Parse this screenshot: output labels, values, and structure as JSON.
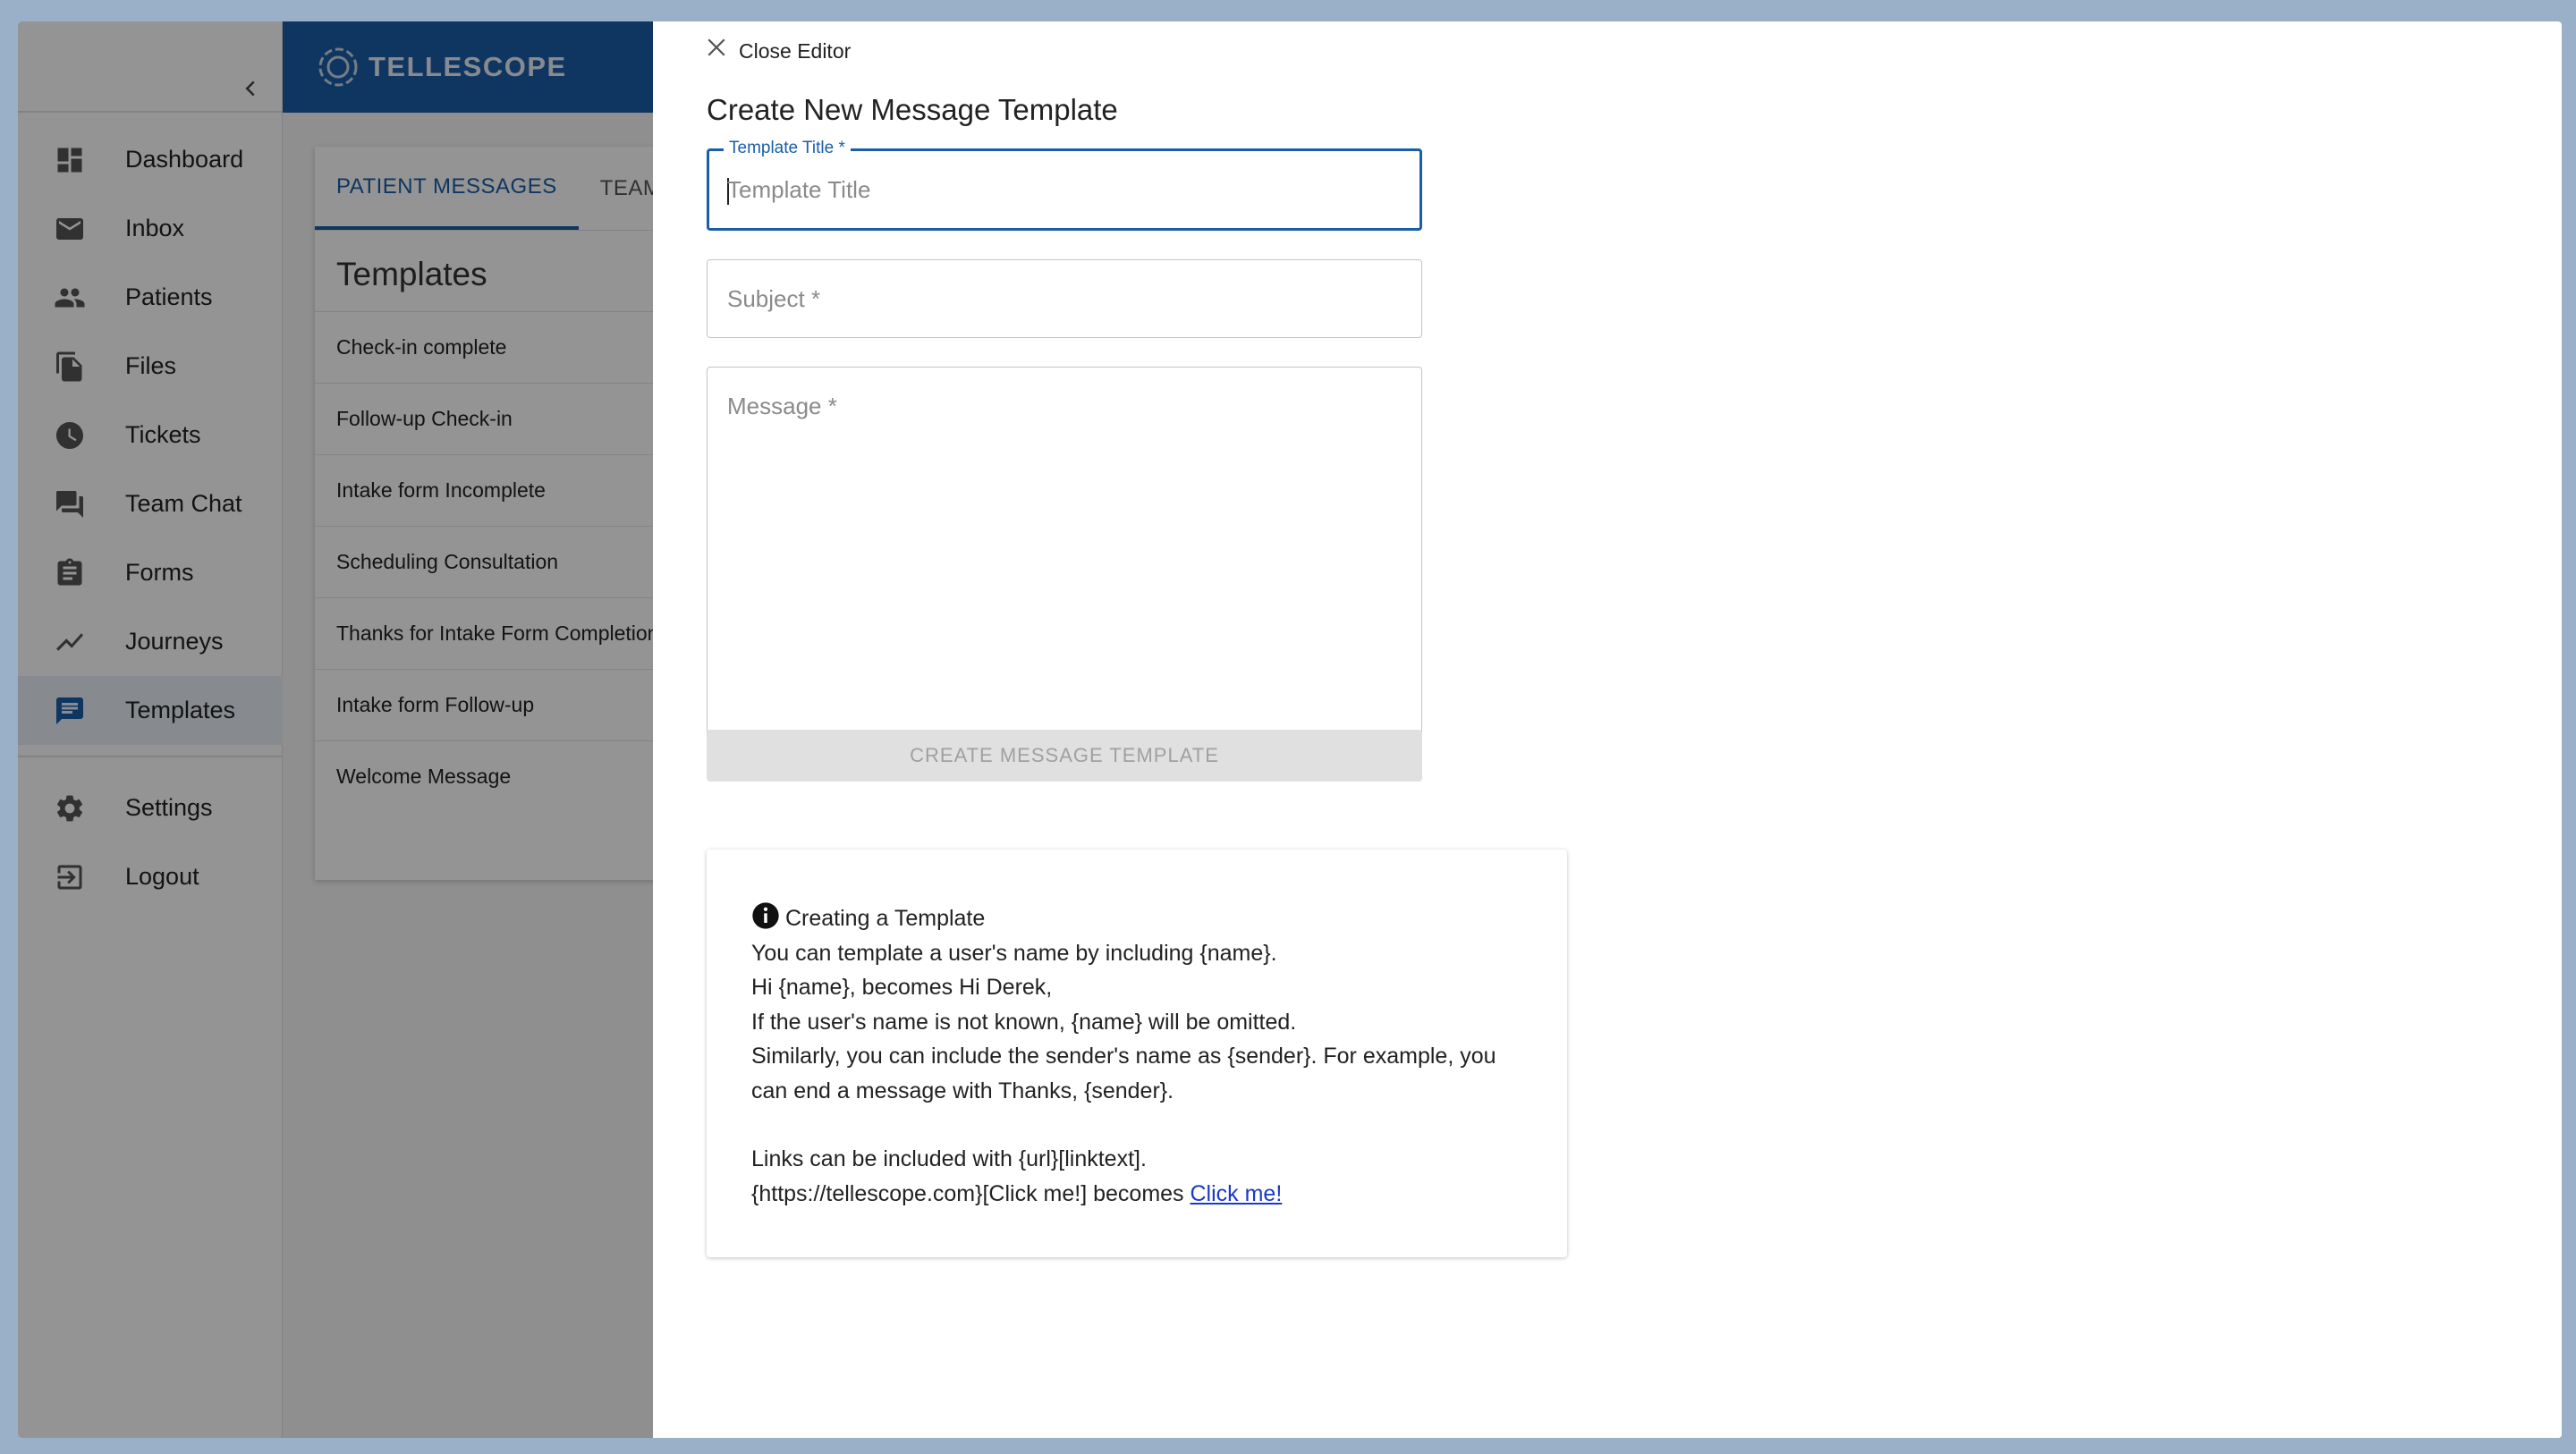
{
  "sidebar": {
    "items": [
      {
        "label": "Dashboard",
        "icon": "dashboard-icon"
      },
      {
        "label": "Inbox",
        "icon": "mail-icon"
      },
      {
        "label": "Patients",
        "icon": "people-icon"
      },
      {
        "label": "Files",
        "icon": "files-icon"
      },
      {
        "label": "Tickets",
        "icon": "clock-icon"
      },
      {
        "label": "Team Chat",
        "icon": "chat-icon"
      },
      {
        "label": "Forms",
        "icon": "clipboard-icon"
      },
      {
        "label": "Journeys",
        "icon": "trending-icon"
      },
      {
        "label": "Templates",
        "icon": "message-icon",
        "active": true
      }
    ],
    "bottom_items": [
      {
        "label": "Settings",
        "icon": "gear-icon"
      },
      {
        "label": "Logout",
        "icon": "logout-icon"
      }
    ]
  },
  "header": {
    "logo_text": "TELLESCOPE",
    "brand_color": "#1a5ea8"
  },
  "templates_panel": {
    "tabs": [
      "PATIENT MESSAGES",
      "TEAM N"
    ],
    "title": "Templates",
    "rows": [
      "Check-in complete",
      "Follow-up Check-in",
      "Intake form Incomplete",
      "Scheduling Consultation",
      "Thanks for Intake Form Completion",
      "Intake form Follow-up",
      "Welcome Message"
    ]
  },
  "editor": {
    "close_label": "Close Editor",
    "title": "Create New Message Template",
    "template_title_label": "Template Title *",
    "template_title_placeholder": "Template Title",
    "subject_placeholder": "Subject *",
    "message_placeholder": "Message *",
    "create_button": "CREATE MESSAGE TEMPLATE"
  },
  "info": {
    "heading": "Creating a Template",
    "line1": "You can template a user's name by including {name}.",
    "line2": "Hi {name}, becomes Hi Derek,",
    "line3": "If the user's name is not known, {name} will be omitted.",
    "line4": "Similarly, you can include the sender's name as {sender}. For example, you can end a message with Thanks, {sender}.",
    "line5": "Links can be included with {url}[linktext].",
    "line6_prefix": "{https://tellescope.com}[Click me!] becomes ",
    "line6_link": "Click me!"
  }
}
